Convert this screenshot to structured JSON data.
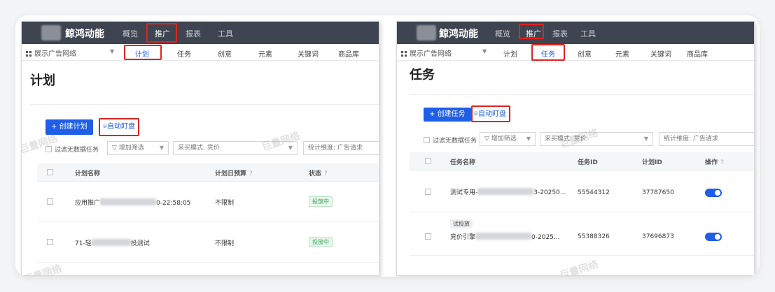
{
  "left": {
    "brand": "鲸鸿动能",
    "topnav": [
      "概览",
      "推广",
      "报表",
      "工具"
    ],
    "network": "展示广告网络",
    "subtabs": [
      "计划",
      "任务",
      "创意",
      "元素",
      "关键词",
      "商品库"
    ],
    "page_title": "计划",
    "create_button": "+  创建计划",
    "auto_button": "自动盯盘",
    "filter_no_data": "过滤无数据任务",
    "add_filter": "增加筛选",
    "buy_mode": "采买模式: 竞价",
    "stat_dim": "统计维度: 广告请求",
    "columns": [
      "计划名称",
      "计划日预算",
      "状态"
    ],
    "rows": [
      {
        "name_prefix": "应用推广",
        "name_suffix": "0-22:58:05",
        "budget": "不限制",
        "status": "投放中"
      },
      {
        "name_prefix": "71-轻",
        "name_suffix": "投测试",
        "budget": "不限制",
        "status": "投放中"
      }
    ],
    "watermark": "巨量网络"
  },
  "right": {
    "brand": "鲸鸿动能",
    "topnav": [
      "概览",
      "推广",
      "报表",
      "工具"
    ],
    "network": "展示广告网络",
    "subtabs": [
      "计划",
      "任务",
      "创意",
      "元素",
      "关键词",
      "商品库"
    ],
    "page_title": "任务",
    "create_button": "+  创建任务",
    "auto_button": "自动盯盘",
    "filter_no_data": "过滤无数据任务",
    "add_filter": "增加筛选",
    "buy_mode": "采买模式: 竞价",
    "stat_dim": "统计维度: 广告请求",
    "columns": [
      "任务名称",
      "任务ID",
      "计划ID",
      "操作"
    ],
    "rows": [
      {
        "tag": "",
        "name_prefix": "测试专用-",
        "name_suffix": "3-20250...",
        "task_id": "55544312",
        "plan_id": "37787650"
      },
      {
        "tag": "试投放",
        "name_prefix": "竞价引擎",
        "name_suffix": "0-2025...",
        "task_id": "55388326",
        "plan_id": "37696873"
      }
    ],
    "watermark": "巨量网络"
  },
  "colors": {
    "accent": "#1f5ee8",
    "highlight": "#e0241e",
    "topbar": "#3e4450"
  }
}
